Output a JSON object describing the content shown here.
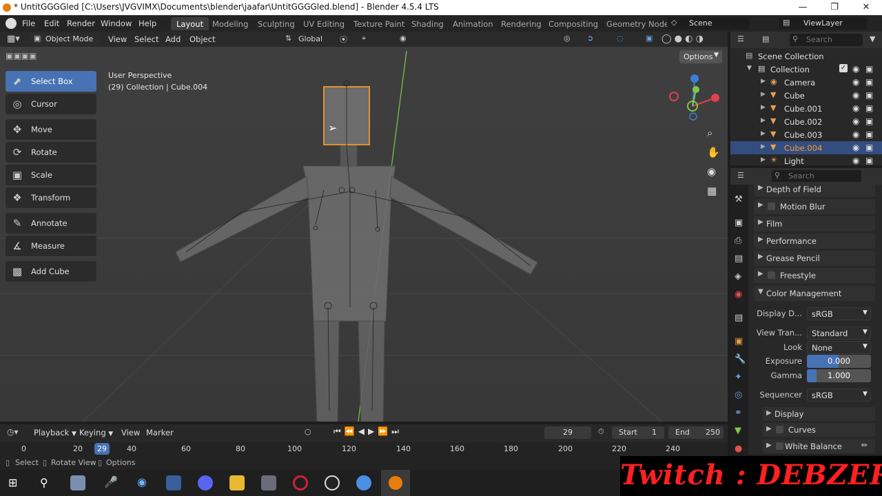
{
  "window": {
    "title": "* UntitGGGGled [C:\\Users\\JVGVIMX\\Documents\\blender\\jaafar\\UntitGGGGled.blend] - Blender 4.5.4 LTS"
  },
  "menus": [
    "File",
    "Edit",
    "Render",
    "Window",
    "Help"
  ],
  "workspaces": [
    "Layout",
    "Modeling",
    "Sculpting",
    "UV Editing",
    "Texture Paint",
    "Shading",
    "Animation",
    "Rendering",
    "Compositing",
    "Geometry Node"
  ],
  "scene": {
    "name": "Scene",
    "view_layer": "ViewLayer"
  },
  "viewport_header": {
    "mode": "Object Mode",
    "menus": [
      "View",
      "Select",
      "Add",
      "Object"
    ],
    "orientation": "Global",
    "options_label": "Options"
  },
  "viewport": {
    "perspective": "User Perspective",
    "info": "(29) Collection | Cube.004"
  },
  "tools": [
    "Select Box",
    "Cursor",
    "Move",
    "Rotate",
    "Scale",
    "Transform",
    "Annotate",
    "Measure",
    "Add Cube"
  ],
  "outliner": {
    "search_placeholder": "Search",
    "root": "Scene Collection",
    "collection": "Collection",
    "items": [
      "Camera",
      "Cube",
      "Cube.001",
      "Cube.002",
      "Cube.003",
      "Cube.004",
      "Light"
    ],
    "selected": "Cube.004"
  },
  "properties": {
    "search_placeholder": "Search",
    "sections": [
      "Depth of Field",
      "Motion Blur",
      "Film",
      "Performance",
      "Grease Pencil",
      "Freestyle",
      "Color Management"
    ],
    "color_management": {
      "display_label": "Display D...",
      "display_value": "sRGB",
      "view_label": "View Tran...",
      "view_value": "Standard",
      "look_label": "Look",
      "look_value": "None",
      "exposure_label": "Exposure",
      "exposure_value": "0.000",
      "gamma_label": "Gamma",
      "gamma_value": "1.000",
      "sequencer_label": "Sequencer",
      "sequencer_value": "sRGB"
    },
    "subsections": [
      "Display",
      "Curves",
      "White Balance"
    ]
  },
  "timeline": {
    "menus": [
      "Playback",
      "Keying",
      "View",
      "Marker"
    ],
    "current_frame": "29",
    "start_label": "Start",
    "start_value": "1",
    "end_label": "End",
    "end_value": "250",
    "ruler": [
      "0",
      "20",
      "40",
      "60",
      "80",
      "100",
      "120",
      "140",
      "160",
      "180",
      "200",
      "220",
      "240"
    ]
  },
  "statusbar": [
    "Select",
    "Rotate View",
    "Options"
  ],
  "overlay": {
    "twitch": "Twitch : DEBZERK"
  },
  "colors": {
    "accent": "#4772b3",
    "selected_object": "#f39c33",
    "twitch_text": "#ff2020",
    "y_axis": "#7fc94a"
  }
}
